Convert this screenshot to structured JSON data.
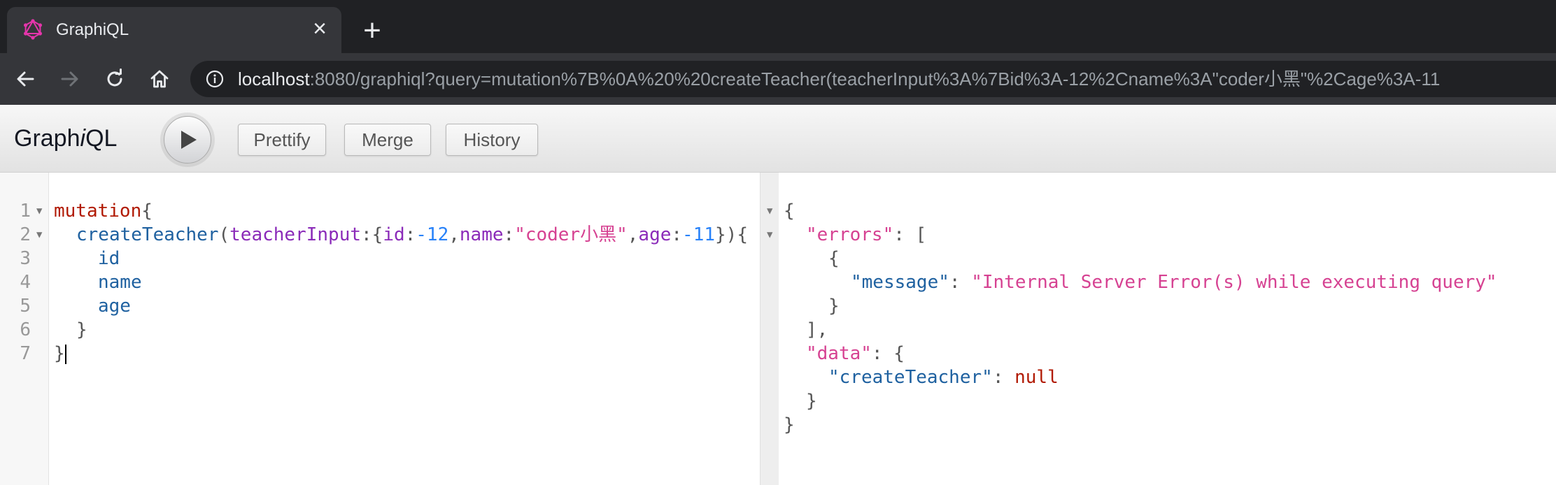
{
  "browser": {
    "tab_title": "GraphiQL",
    "close_glyph": "×",
    "new_tab_glyph": "+",
    "url_host": "localhost",
    "url_rest": ":8080/graphiql?query=mutation%7B%0A%20%20createTeacher(teacherInput%3A%7Bid%3A-12%2Cname%3A\"coder小黑\"%2Cage%3A-11"
  },
  "graphiql": {
    "title_pre": "Graph",
    "title_i": "i",
    "title_post": "QL",
    "buttons": {
      "prettify": "Prettify",
      "merge": "Merge",
      "history": "History"
    }
  },
  "query": {
    "line_numbers": [
      "1",
      "2",
      "3",
      "4",
      "5",
      "6",
      "7"
    ],
    "l1_keyword": "mutation",
    "l1_brace": "{",
    "l2_field": "createTeacher",
    "l2_open": "(",
    "l2_arg": "teacherInput",
    "l2_colon1": ":{",
    "l2_id_key": "id",
    "l2_colon2": ":",
    "l2_id_val": "-12",
    "l2_comma1": ",",
    "l2_name_key": "name",
    "l2_colon3": ":",
    "l2_name_val": "\"coder小黑\"",
    "l2_comma2": ",",
    "l2_age_key": "age",
    "l2_colon4": ":",
    "l2_age_val": "-11",
    "l2_close": "}){",
    "l3": "id",
    "l4": "name",
    "l5": "age",
    "l6": "}",
    "l7": "}"
  },
  "result": {
    "r1": "{",
    "errors_key": "\"errors\"",
    "errors_colon": ": [",
    "r3": "{",
    "message_key": "\"message\"",
    "message_colon": ": ",
    "message_val": "\"Internal Server Error(s) while executing query\"",
    "r5": "}",
    "r6": "],",
    "data_key": "\"data\"",
    "data_colon": ": {",
    "ct_key": "\"createTeacher\"",
    "ct_colon": ": ",
    "ct_val": "null",
    "r9": "}",
    "r10": "}"
  },
  "icons": {
    "tab_favicon": "graphql-logo-icon",
    "back": "back-arrow-icon",
    "forward": "forward-arrow-icon",
    "reload": "reload-icon",
    "home": "home-icon",
    "info": "info-icon",
    "execute": "play-icon",
    "fold": "fold-arrow-icon"
  },
  "colors": {
    "graphql_pink": "#e535ab",
    "keyword": "#b11a04",
    "string": "#d64292",
    "number": "#2882f9",
    "property": "#1f61a0",
    "argument": "#8b2bb9"
  }
}
